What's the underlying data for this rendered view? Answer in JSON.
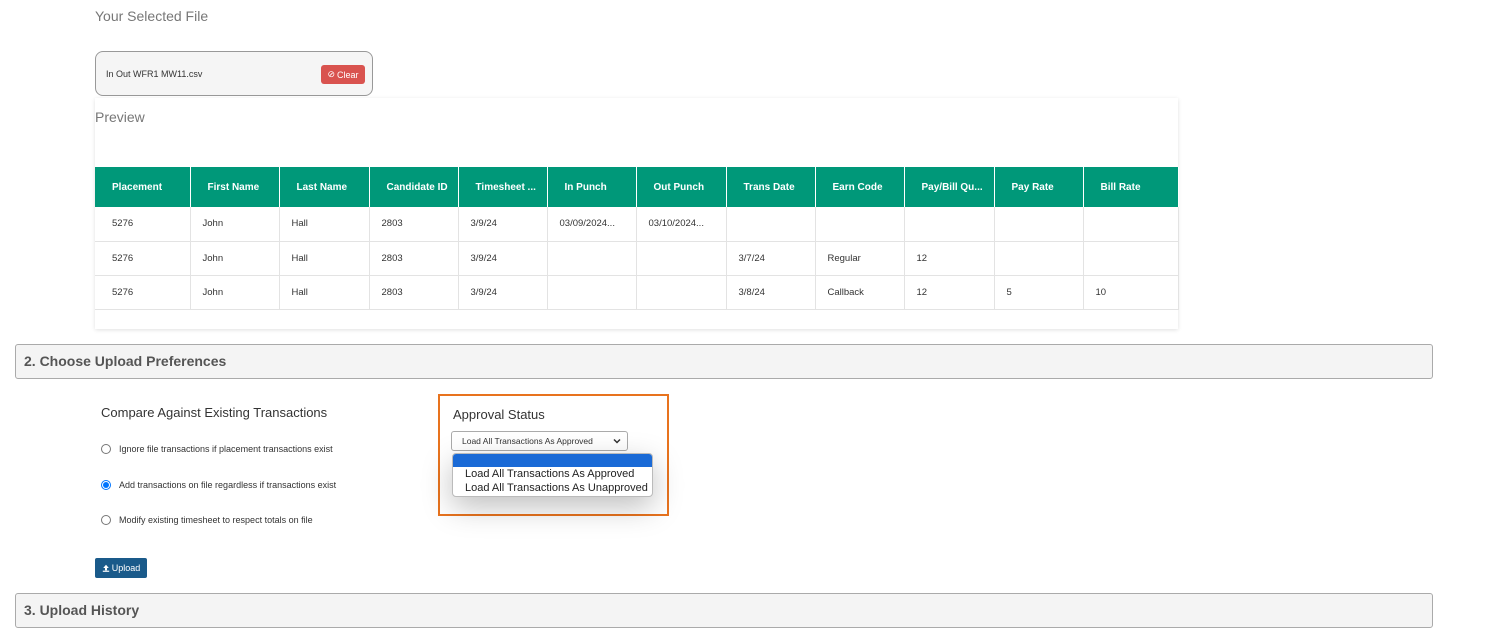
{
  "file_section": {
    "title": "Your Selected File",
    "file_name": "In Out WFR1 MW11.csv",
    "clear_label": "Clear"
  },
  "preview": {
    "title": "Preview",
    "columns": [
      "Placement",
      "First Name",
      "Last Name",
      "Candidate ID",
      "Timesheet ...",
      "In Punch",
      "Out Punch",
      "Trans Date",
      "Earn Code",
      "Pay/Bill Qu...",
      "Pay Rate",
      "Bill Rate"
    ],
    "rows": [
      [
        "5276",
        "John",
        "Hall",
        "2803",
        "3/9/24",
        "03/09/2024...",
        "03/10/2024...",
        "",
        "",
        "",
        "",
        ""
      ],
      [
        "5276",
        "John",
        "Hall",
        "2803",
        "3/9/24",
        "",
        "",
        "3/7/24",
        "Regular",
        "12",
        "",
        ""
      ],
      [
        "5276",
        "John",
        "Hall",
        "2803",
        "3/9/24",
        "",
        "",
        "3/8/24",
        "Callback",
        "12",
        "5",
        "10"
      ]
    ]
  },
  "preferences": {
    "header": "2. Choose Upload Preferences",
    "compare_title": "Compare Against Existing Transactions",
    "options": [
      {
        "label": "Ignore file transactions if placement transactions exist",
        "checked": false
      },
      {
        "label": "Add transactions on file regardless if transactions exist",
        "checked": true
      },
      {
        "label": "Modify existing timesheet to respect totals on file",
        "checked": false
      }
    ],
    "approval_title": "Approval Status",
    "approval_selected": "Load All Transactions As Approved",
    "approval_options": [
      "Load All Transactions As Approved",
      "Load All Transactions As Unapproved"
    ],
    "upload_label": "Upload"
  },
  "history": {
    "header": "3. Upload History"
  },
  "colors": {
    "table_header": "#009879",
    "clear_button": "#d9534f",
    "upload_button": "#1a5a8a",
    "highlight_border": "#e8731e",
    "dropdown_selected": "#1a6ad6"
  }
}
